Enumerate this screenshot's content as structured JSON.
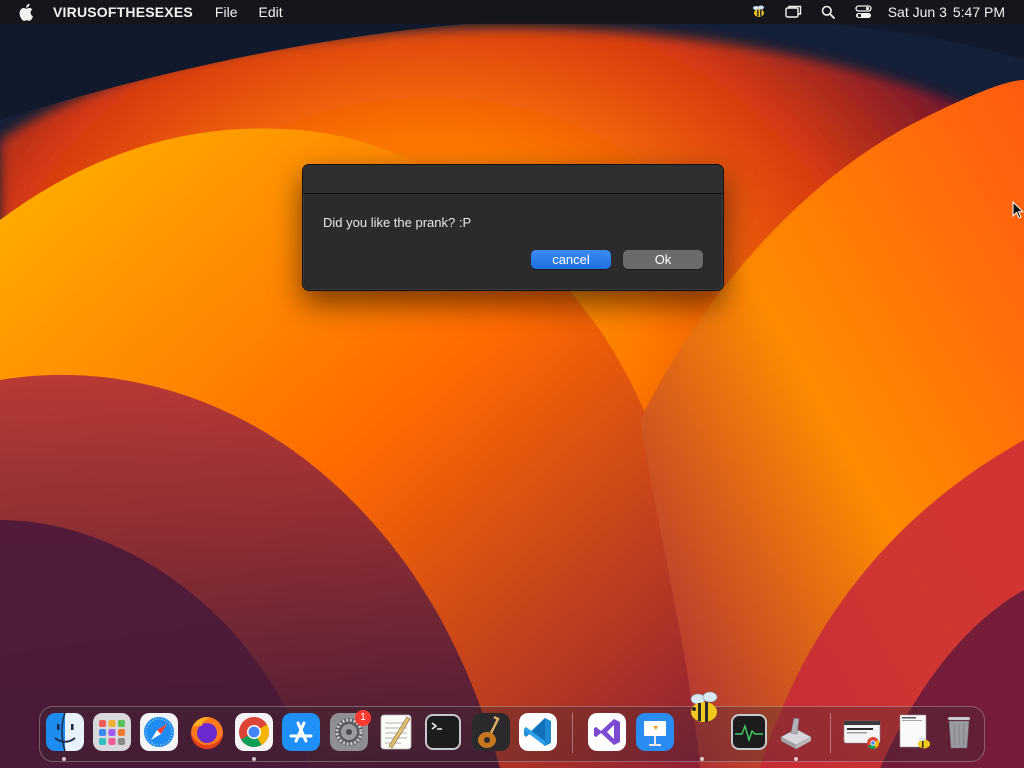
{
  "menubar": {
    "app_name": "VIRUSOFTHESEXES",
    "menus": [
      "File",
      "Edit"
    ],
    "clock": {
      "date": "Sat Jun 3",
      "time": "5:47 PM"
    }
  },
  "dialog": {
    "message": "Did you like the prank? :P",
    "cancel_label": "cancel",
    "ok_label": "Ok"
  },
  "dock": {
    "badge_count": "1"
  },
  "colors": {
    "accent_button": "#2a7ce8",
    "secondary_button": "#6b6b6e",
    "dialog_bg": "#2b2b2d",
    "menubar_bg": "#16161a"
  }
}
